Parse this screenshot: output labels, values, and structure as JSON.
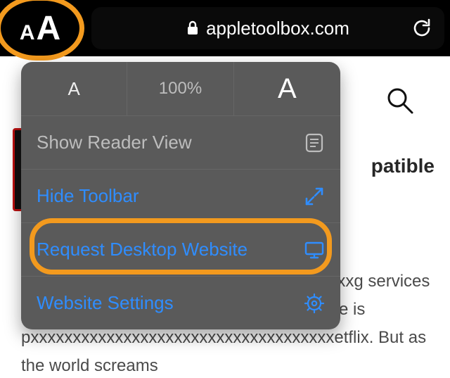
{
  "urlbar": {
    "domain": "appletoolbox.com"
  },
  "aa_button": {
    "small": "A",
    "big": "A"
  },
  "popover": {
    "zoom": {
      "small_a": "A",
      "percent": "100%",
      "big_a": "A"
    },
    "reader_label": "Show Reader View",
    "hide_toolbar_label": "Hide Toolbar",
    "request_desktop_label": "Request Desktop Website",
    "website_settings_label": "Website Settings"
  },
  "page": {
    "headline_fragment": "patible",
    "body_text": "Nxxxxxxxxxxxxxxxxxxxxxxxxxxxxxxxxxxxxxxg services oxxxxxxxxxxxxxxxxxxxxxxxxxxxxxxxxxxxple is pxxxxxxxxxxxxxxxxxxxxxxxxxxxxxxxxxxxxetflix. But as the world screams"
  }
}
